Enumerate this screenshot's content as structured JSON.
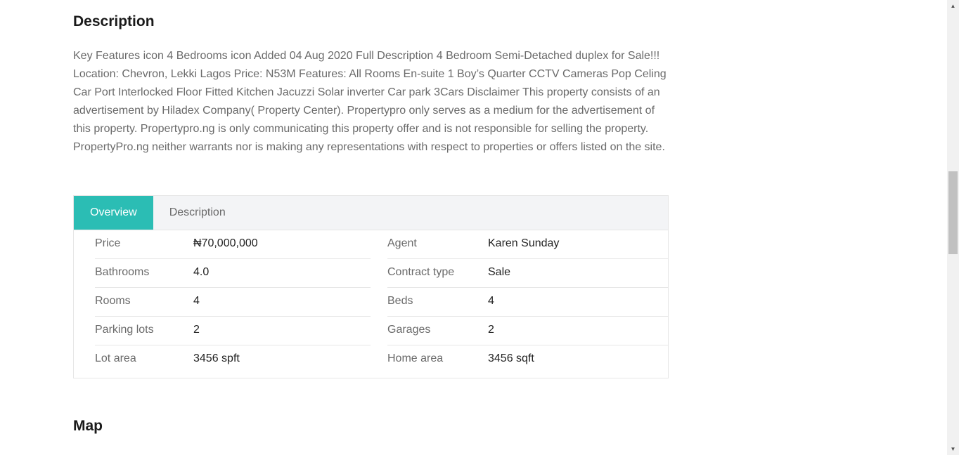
{
  "description": {
    "title": "Description",
    "text": "Key Features icon 4 Bedrooms icon Added 04 Aug 2020 Full Description 4 Bedroom Semi-Detached duplex for Sale!!! Location: Chevron, Lekki Lagos Price: N53M Features: All Rooms En-suite 1 Boy’s Quarter CCTV Cameras Pop Celing Car Port Interlocked Floor Fitted Kitchen Jacuzzi Solar inverter Car park 3Cars Disclaimer This property consists of an advertisement by Hiladex Company( Property Center). Propertypro only serves as a medium for the advertisement of this property. Propertypro.ng is only communicating this property offer and is not responsible for selling the property. PropertyPro.ng neither warrants nor is making any representations with respect to properties or offers listed on the site."
  },
  "tabs": [
    {
      "label": "Overview",
      "active": true
    },
    {
      "label": "Description",
      "active": false
    }
  ],
  "overview": {
    "left": [
      {
        "label": "Price",
        "value": "₦70,000,000"
      },
      {
        "label": "Bathrooms",
        "value": "4.0"
      },
      {
        "label": "Rooms",
        "value": "4"
      },
      {
        "label": "Parking lots",
        "value": "2"
      },
      {
        "label": "Lot area",
        "value": "3456 spft"
      }
    ],
    "right": [
      {
        "label": "Agent",
        "value": "Karen Sunday"
      },
      {
        "label": "Contract type",
        "value": "Sale"
      },
      {
        "label": "Beds",
        "value": "4"
      },
      {
        "label": "Garages",
        "value": "2"
      },
      {
        "label": "Home area",
        "value": "3456 sqft"
      }
    ]
  },
  "map": {
    "title": "Map"
  },
  "colors": {
    "accent": "#2bbdb4",
    "tab_bar_bg": "#f3f4f6",
    "muted_text": "#6a6a6a"
  },
  "scrollbar": {
    "up_icon": "triangle-up-icon",
    "down_icon": "triangle-down-icon"
  }
}
